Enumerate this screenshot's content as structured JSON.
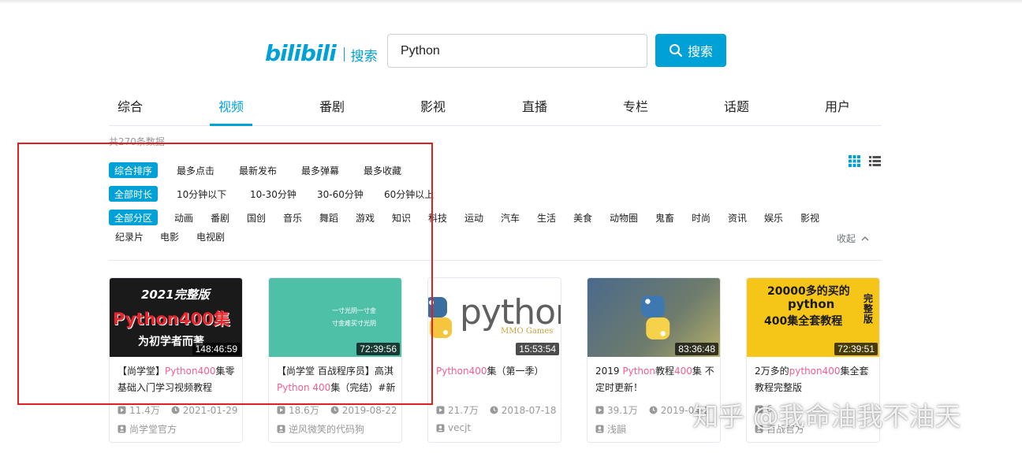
{
  "header": {
    "logo_mark": "bilibili",
    "logo_text": "搜索",
    "search_value": "Python",
    "search_button": "搜索"
  },
  "tabs": [
    "综合",
    "视频",
    "番剧",
    "影视",
    "直播",
    "专栏",
    "话题",
    "用户"
  ],
  "active_tab": "视频",
  "total_text": "共270条数据",
  "filters": {
    "order": [
      "综合排序",
      "最多点击",
      "最新发布",
      "最多弹幕",
      "最多收藏"
    ],
    "duration": [
      "全部时长",
      "10分钟以下",
      "10-30分钟",
      "30-60分钟",
      "60分钟以上"
    ],
    "zone": [
      "全部分区",
      "动画",
      "番剧",
      "国创",
      "音乐",
      "舞蹈",
      "游戏",
      "知识",
      "科技",
      "运动",
      "汽车",
      "生活",
      "美食",
      "动物圈",
      "鬼畜",
      "时尚",
      "资讯",
      "娱乐",
      "影视",
      "纪录片",
      "电影",
      "电视剧"
    ],
    "collapse_label": "收起"
  },
  "videos": [
    {
      "thumb_top": "2021完整版",
      "thumb_mid": "Python400集",
      "thumb_bottom": "为初学者而著",
      "duration": "148:46:59",
      "title_parts": [
        "【尚学堂】",
        "Python400",
        "集零基础入门学习视频教程"
      ],
      "views": "11.4万",
      "date": "2021-01-29",
      "uploader": "尚学堂官方"
    },
    {
      "thumb_top": "一寸光阴一寸金",
      "thumb_bottom": "寸金难买寸光阴",
      "duration": "72:39:56",
      "title_parts": [
        "【尚学堂 百战程序员】高淇",
        "Python 400",
        "集（完结）#新"
      ],
      "views": "18.6万",
      "date": "2019-08-22",
      "uploader": "逆风微笑的代码狗"
    },
    {
      "thumb_top": "python",
      "thumb_bottom": "MMO Games",
      "duration": "15:53:54",
      "title_parts": [
        "",
        "Python400",
        "集（第一季）"
      ],
      "views": "21.7万",
      "date": "2018-07-18",
      "uploader": "vecjt"
    },
    {
      "duration": "83:36:48",
      "title_parts": [
        "2019 ",
        "Python",
        "教程",
        "400",
        "集 不定时更新！"
      ],
      "views": "39.1万",
      "date": "2019-04-2",
      "uploader": "浅韻"
    },
    {
      "thumb_top": "20000多的买的",
      "thumb_mid": "python",
      "thumb_bottom": "400集全套教程",
      "thumb_side": "完整版",
      "duration": "72:39:51",
      "title_parts": [
        "2万多的",
        "python400",
        "集全套教程完整版"
      ],
      "views": "6",
      "date": "",
      "uploader": "百战官方"
    }
  ],
  "watermark": "知乎 @我命油我不油天",
  "colors": {
    "accent": "#00a1d6",
    "highlight": "#f25d8e",
    "annotation": "#e02020"
  }
}
